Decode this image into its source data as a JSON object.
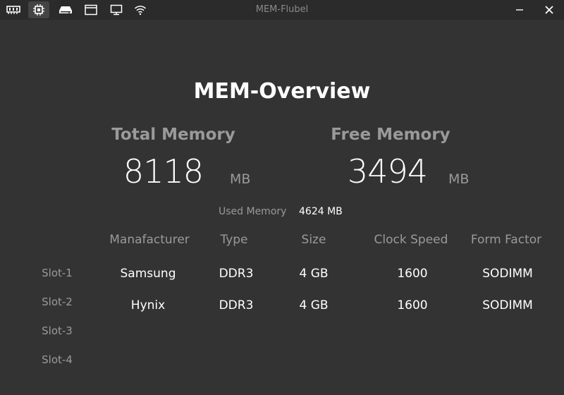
{
  "window": {
    "title": "MEM-Flubel",
    "toolbar_icons": [
      "memory-icon",
      "cpu-icon",
      "disk-icon",
      "window-icon",
      "monitor-icon",
      "wifi-icon"
    ],
    "active_icon": "cpu-icon"
  },
  "overview": {
    "heading": "MEM-Overview",
    "total": {
      "label": "Total Memory",
      "value": "8118",
      "unit": "MB"
    },
    "free": {
      "label": "Free Memory",
      "value": "3494",
      "unit": "MB"
    },
    "used": {
      "label": "Used Memory",
      "value": "4624 MB"
    }
  },
  "table": {
    "columns": [
      "Manafacturer",
      "Type",
      "Size",
      "Clock Speed",
      "Form Factor"
    ],
    "slots": [
      "Slot-1",
      "Slot-2",
      "Slot-3",
      "Slot-4"
    ],
    "rows": [
      [
        "Samsung",
        "DDR3",
        "4 GB",
        "1600",
        "SODIMM"
      ],
      [
        "Hynix",
        "DDR3",
        "4 GB",
        "1600",
        "SODIMM"
      ]
    ]
  },
  "colors": {
    "background": "#333333",
    "titlebar": "#2b2b2b",
    "muted_text": "#9a9a9a",
    "primary_text": "#ffffff"
  }
}
